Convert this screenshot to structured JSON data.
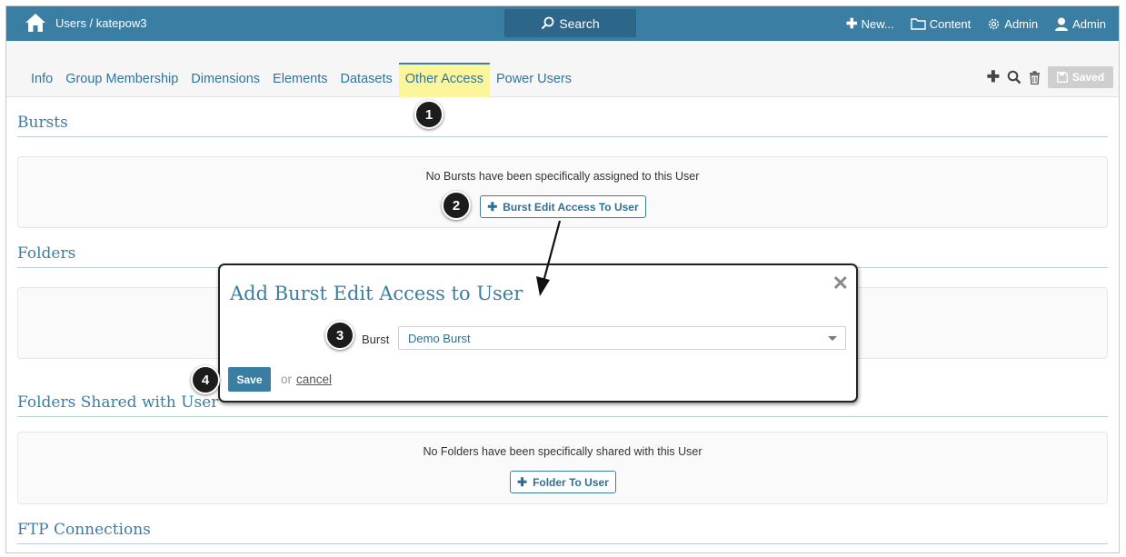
{
  "topbar": {
    "breadcrumb": "Users / katepow3",
    "search_label": "Search",
    "new_label": "New...",
    "content_label": "Content",
    "admin_gear_label": "Admin",
    "admin_user_label": "Admin"
  },
  "tabs": [
    {
      "label": "Info",
      "active": false
    },
    {
      "label": "Group Membership",
      "active": false
    },
    {
      "label": "Dimensions",
      "active": false
    },
    {
      "label": "Elements",
      "active": false
    },
    {
      "label": "Datasets",
      "active": false
    },
    {
      "label": "Other Access",
      "active": true
    },
    {
      "label": "Power Users",
      "active": false
    }
  ],
  "toolbar": {
    "saved_label": "Saved"
  },
  "sections": {
    "bursts": {
      "title": "Bursts",
      "empty_text": "No Bursts have been specifically assigned to this User",
      "button_label": "Burst Edit Access To User"
    },
    "folders": {
      "title": "Folders"
    },
    "folders_shared": {
      "title": "Folders Shared with User",
      "empty_text": "No Folders have been specifically shared with this User",
      "button_label": "Folder To User"
    },
    "ftp": {
      "title": "FTP Connections"
    }
  },
  "modal": {
    "title": "Add Burst Edit Access to User",
    "close_glyph": "✕",
    "burst_label": "Burst",
    "burst_value": "Demo Burst",
    "save_label": "Save",
    "or_text": "or",
    "cancel_label": "cancel"
  },
  "steps": [
    "1",
    "2",
    "3",
    "4"
  ],
  "colors": {
    "brand": "#3a7fa3",
    "active_tab": "#fbf59b",
    "badge": "#1c1c1c"
  }
}
